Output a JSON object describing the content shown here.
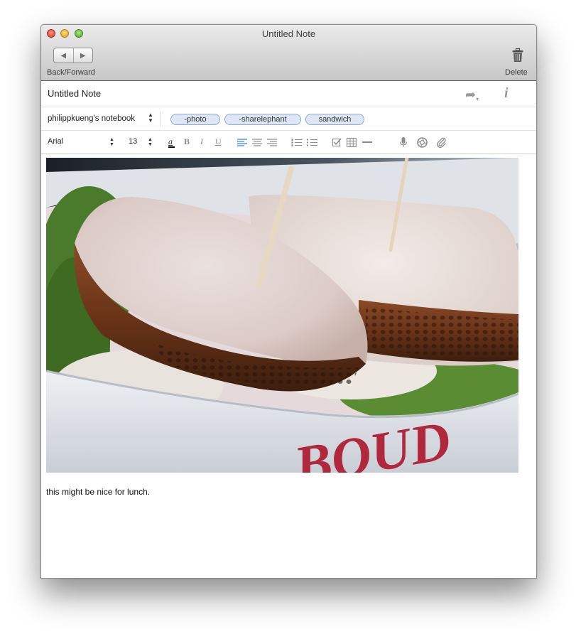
{
  "window": {
    "title": "Untitled Note"
  },
  "toolbar": {
    "back_forward_label": "Back/Forward",
    "delete_label": "Delete",
    "back_icon": "◀",
    "forward_icon": "▶"
  },
  "note": {
    "title": "Untitled Note",
    "notebook": "philippkueng's notebook",
    "tags": [
      "-photo",
      "-sharelephant",
      "sandwich"
    ],
    "body_text": "this might be nice for lunch."
  },
  "format": {
    "font_name": "Arial",
    "font_size": "13",
    "icons": [
      "text-color-icon",
      "bold-icon",
      "italic-icon",
      "underline-icon",
      "align-left-icon",
      "align-center-icon",
      "align-right-icon",
      "bullet-list-icon",
      "numbered-list-icon",
      "checkbox-icon",
      "table-icon",
      "horizontal-rule-icon",
      "microphone-icon",
      "camera-icon",
      "attachment-icon"
    ],
    "active_color": "#2f7fd8"
  },
  "image": {
    "subject": "sandwich-photo",
    "brand_text": "BOUD"
  }
}
